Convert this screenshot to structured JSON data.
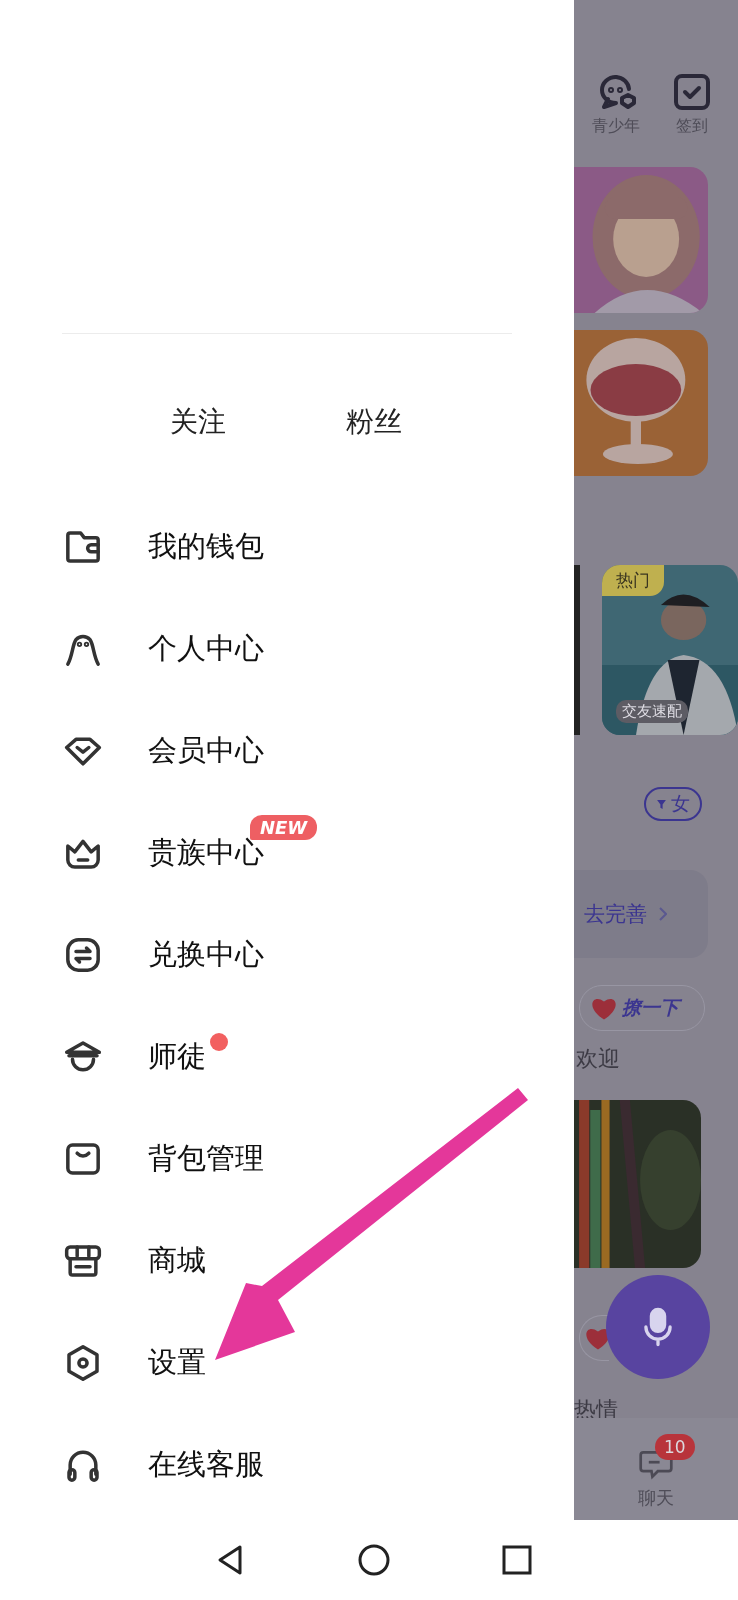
{
  "drawer": {
    "stats": [
      {
        "label": "关注"
      },
      {
        "label": "粉丝"
      }
    ],
    "menu": [
      {
        "label": "我的钱包",
        "kind": "wallet"
      },
      {
        "label": "个人中心",
        "kind": "person"
      },
      {
        "label": "会员中心",
        "kind": "diamond"
      },
      {
        "label": "贵族中心",
        "kind": "crown",
        "badge": "NEW"
      },
      {
        "label": "兑换中心",
        "kind": "exchange"
      },
      {
        "label": "师徒",
        "kind": "hat",
        "dot": true
      },
      {
        "label": "背包管理",
        "kind": "bag"
      },
      {
        "label": "商城",
        "kind": "shop"
      },
      {
        "label": "设置",
        "kind": "settings"
      },
      {
        "label": "在线客服",
        "kind": "headset"
      }
    ]
  },
  "background_app": {
    "top_icons": [
      {
        "label": "青少年",
        "kind": "teen"
      },
      {
        "label": "签到",
        "kind": "checkin"
      }
    ],
    "hot_card": {
      "tag": "热门",
      "caption": "交友速配"
    },
    "filter_chip": "女",
    "profile_prompt": "去完善",
    "flirt_button": "撩一下",
    "section_title": "欢迎",
    "second_title": "热情",
    "chat_tab": {
      "label": "聊天",
      "badge": "10"
    }
  }
}
